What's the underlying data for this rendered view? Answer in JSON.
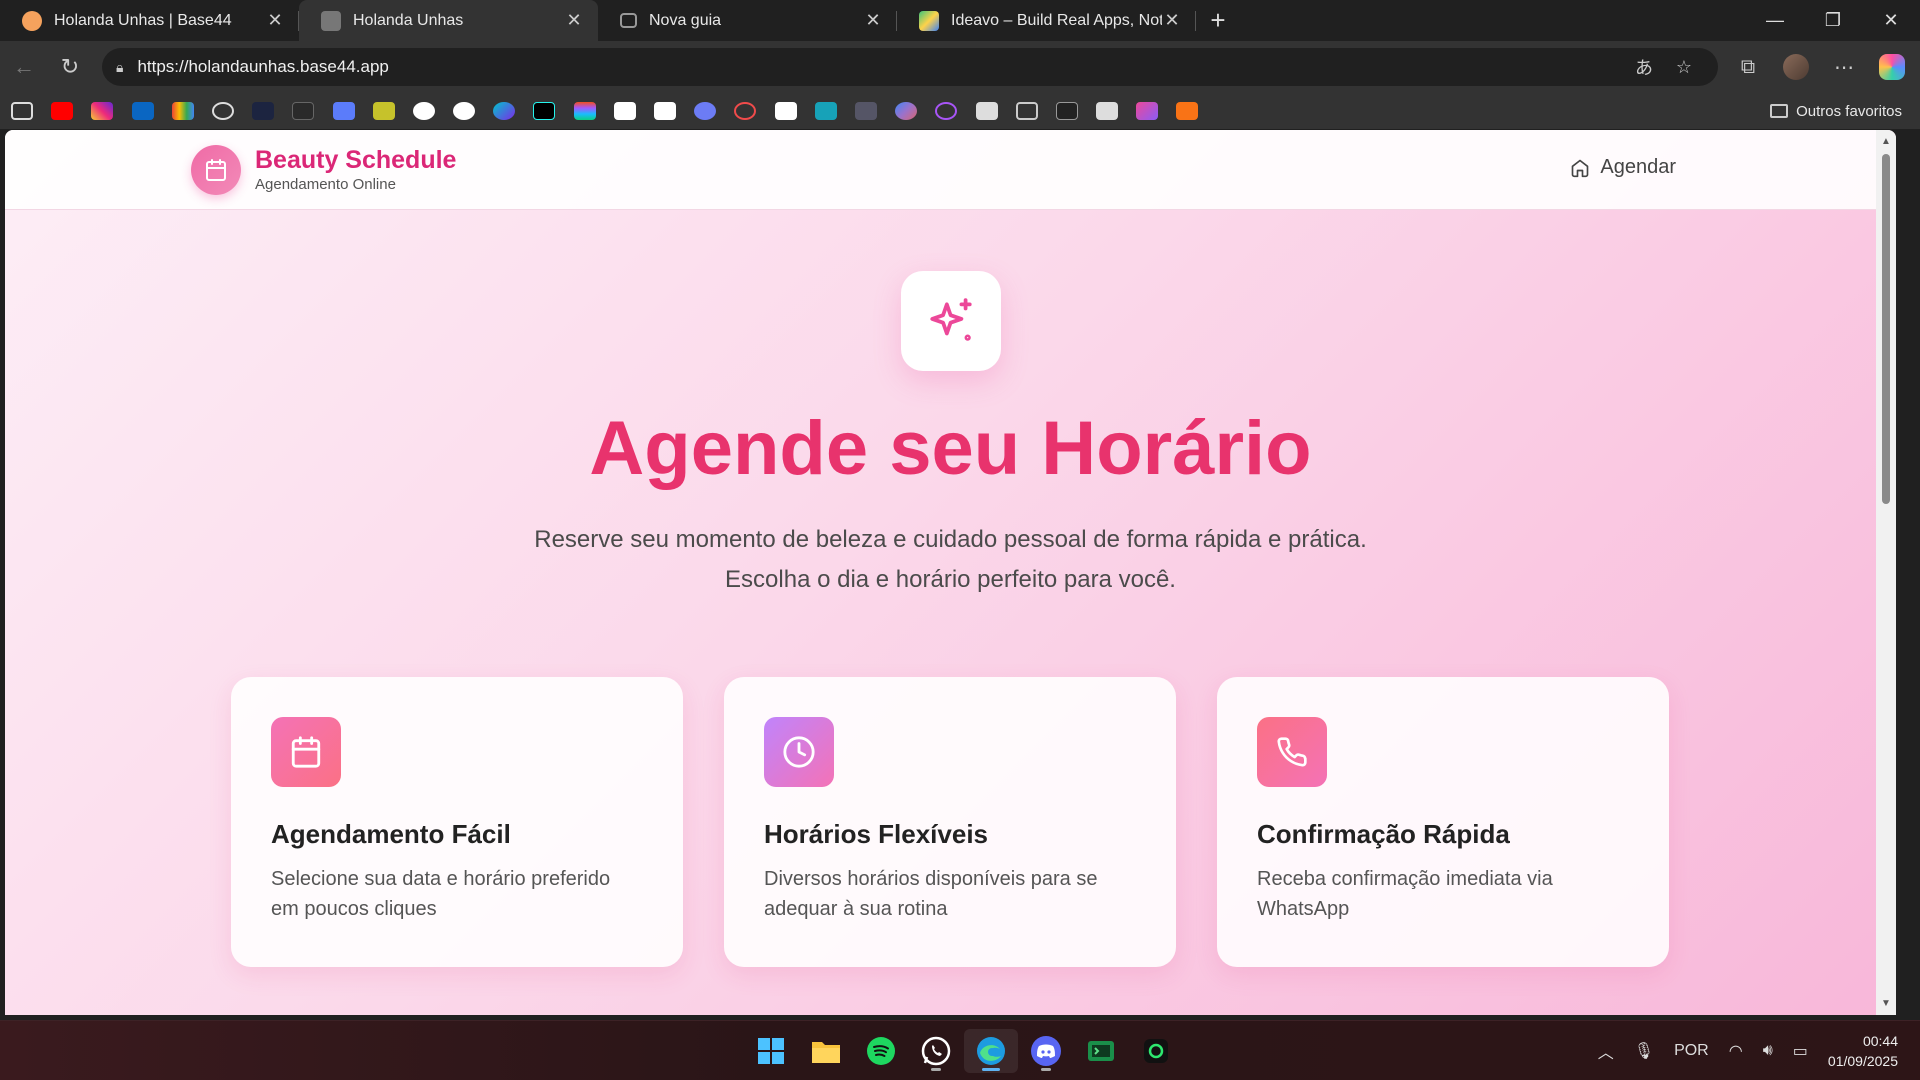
{
  "browser": {
    "tabs": [
      {
        "title": "Holanda Unhas | Base44",
        "active": false
      },
      {
        "title": "Holanda Unhas",
        "active": true
      },
      {
        "title": "Nova guia",
        "active": false
      },
      {
        "title": "Ideavo – Build Real Apps, Not Pro",
        "active": false
      }
    ],
    "url": "https://holandaunhas.base44.app",
    "other_favorites": "Outros favoritos"
  },
  "site": {
    "brand_title": "Beauty Schedule",
    "brand_subtitle": "Agendamento Online",
    "nav_schedule": "Agendar"
  },
  "hero": {
    "title": "Agende seu Horário",
    "subtitle_line1": "Reserve seu momento de beleza e cuidado pessoal de forma rápida e prática.",
    "subtitle_line2": "Escolha o dia e horário perfeito para você."
  },
  "features": [
    {
      "title": "Agendamento Fácil",
      "description": "Selecione sua data e horário preferido em poucos cliques",
      "icon": "calendar-icon"
    },
    {
      "title": "Horários Flexíveis",
      "description": "Diversos horários disponíveis para se adequar à sua rotina",
      "icon": "clock-icon"
    },
    {
      "title": "Confirmação Rápida",
      "description": "Receba confirmação imediata via WhatsApp",
      "icon": "phone-icon"
    }
  ],
  "colors": {
    "brand_pink": "#db2777",
    "hero_title": "#e8336d"
  },
  "taskbar": {
    "language": "POR",
    "time": "00:44",
    "date": "01/09/2025"
  }
}
